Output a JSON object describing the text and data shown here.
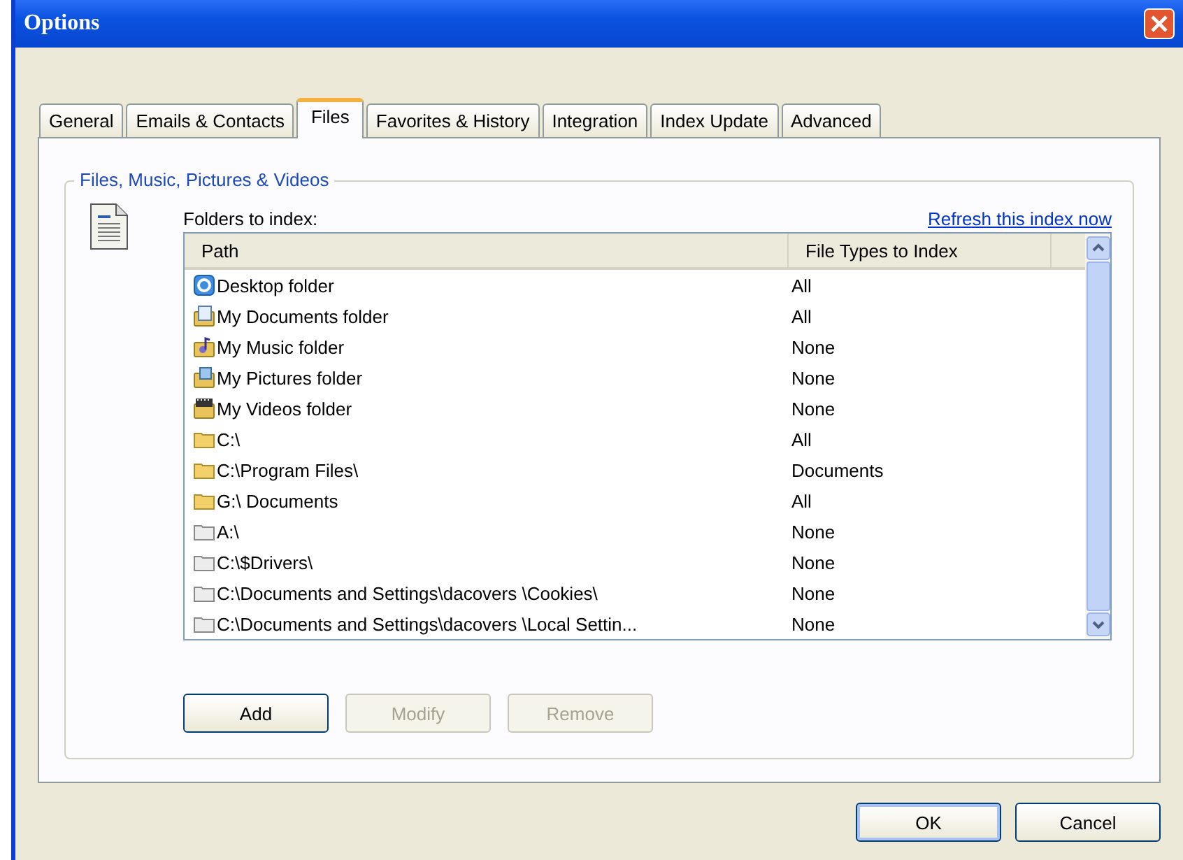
{
  "window": {
    "title": "Options"
  },
  "tabs": [
    {
      "label": "General",
      "selected": false
    },
    {
      "label": "Emails & Contacts",
      "selected": false
    },
    {
      "label": "Files",
      "selected": true
    },
    {
      "label": "Favorites & History",
      "selected": false
    },
    {
      "label": "Integration",
      "selected": false
    },
    {
      "label": "Index Update",
      "selected": false
    },
    {
      "label": "Advanced",
      "selected": false
    }
  ],
  "group": {
    "title": "Files, Music, Pictures & Videos",
    "folders_label": "Folders to index:",
    "refresh_link": "Refresh this index now"
  },
  "table": {
    "columns": [
      "Path",
      "File Types to Index"
    ],
    "rows": [
      {
        "kind": "desktop",
        "path": "Desktop folder",
        "types": "All"
      },
      {
        "kind": "documents",
        "path": "My Documents folder",
        "types": "All"
      },
      {
        "kind": "music",
        "path": "My Music folder",
        "types": "None"
      },
      {
        "kind": "pictures",
        "path": "My Pictures folder",
        "types": "None"
      },
      {
        "kind": "videos",
        "path": "My Videos folder",
        "types": "None"
      },
      {
        "kind": "folder",
        "path": "C:\\",
        "types": "All"
      },
      {
        "kind": "folder",
        "path": "C:\\Program Files\\",
        "types": "Documents"
      },
      {
        "kind": "folder",
        "path": "G:\\ Documents",
        "types": "All"
      },
      {
        "kind": "grey-folder",
        "path": "A:\\",
        "types": "None"
      },
      {
        "kind": "grey-folder",
        "path": "C:\\$Drivers\\",
        "types": "None"
      },
      {
        "kind": "grey-folder",
        "path": "C:\\Documents and Settings\\dacovers \\Cookies\\",
        "types": "None"
      },
      {
        "kind": "grey-folder",
        "path": "C:\\Documents and Settings\\dacovers \\Local Settin...",
        "types": "None"
      }
    ]
  },
  "list_buttons": [
    {
      "label": "Add",
      "disabled": false
    },
    {
      "label": "Modify",
      "disabled": true
    },
    {
      "label": "Remove",
      "disabled": true
    }
  ],
  "dialog_buttons": [
    {
      "label": "OK",
      "default": true
    },
    {
      "label": "Cancel",
      "default": false
    }
  ]
}
